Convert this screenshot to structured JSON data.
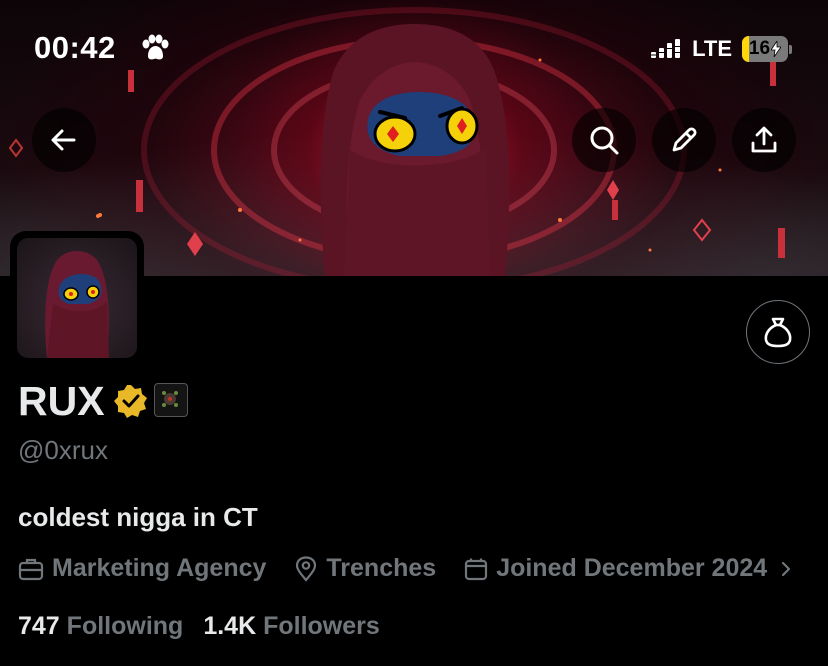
{
  "status_bar": {
    "time": "00:42",
    "network": "LTE",
    "battery": "16",
    "battery_level": 0.16
  },
  "header": {
    "back_icon": "arrow-left-icon",
    "search_icon": "search-icon",
    "edit_icon": "pencil-icon",
    "share_icon": "share-icon"
  },
  "profile": {
    "display_name": "RUX",
    "handle": "@0xrux",
    "bio": "coldest nigga in CT",
    "category": "Marketing Agency",
    "location": "Trenches",
    "joined": "Joined December 2024",
    "following_count": "747",
    "following_label": "Following",
    "followers_count": "1.4K",
    "followers_label": "Followers",
    "tip_icon": "money-bag-icon"
  },
  "colors": {
    "background": "#000000",
    "text_primary": "#e7e9ea",
    "text_secondary": "#71767b",
    "verified_gold": "#e8b829",
    "battery_yellow": "#ffd60a"
  }
}
